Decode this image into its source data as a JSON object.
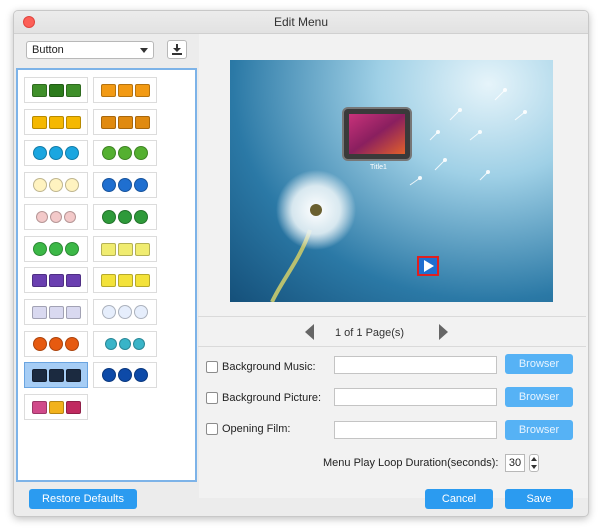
{
  "window": {
    "title": "Edit Menu"
  },
  "left": {
    "select_value": "Button",
    "thumbnails": [
      {
        "style": "sq",
        "colors": [
          "#3f8f2a",
          "#2c7b1c",
          "#3f8f2a"
        ]
      },
      {
        "style": "sq",
        "colors": [
          "#f29a14",
          "#f29a14",
          "#f29a14"
        ]
      },
      {
        "style": "sq",
        "colors": [
          "#f5b800",
          "#f5b800",
          "#f5b800"
        ]
      },
      {
        "style": "sq",
        "colors": [
          "#e08a10",
          "#e08a10",
          "#e08a10"
        ]
      },
      {
        "style": "ci",
        "colors": [
          "#1aa6e0",
          "#1aa6e0",
          "#1aa6e0"
        ]
      },
      {
        "style": "ci",
        "colors": [
          "#54b030",
          "#54b030",
          "#54b030"
        ]
      },
      {
        "style": "ci",
        "colors": [
          "#fff3c0",
          "#fff3c0",
          "#fff3c0"
        ]
      },
      {
        "style": "ci",
        "colors": [
          "#1f6fd0",
          "#1f6fd0",
          "#1f6fd0"
        ]
      },
      {
        "style": "sm",
        "colors": [
          "#f3c9c9",
          "#f3c9c9",
          "#f3c9c9"
        ]
      },
      {
        "style": "ci",
        "colors": [
          "#2e9a3a",
          "#2e9a3a",
          "#2e9a3a"
        ]
      },
      {
        "style": "ci",
        "colors": [
          "#3cb847",
          "#3cb847",
          "#3cb847"
        ]
      },
      {
        "style": "sq",
        "colors": [
          "#f0ec70",
          "#f0ec70",
          "#f0ec70"
        ]
      },
      {
        "style": "sq",
        "colors": [
          "#6a3fb0",
          "#6a3fb0",
          "#6a3fb0"
        ]
      },
      {
        "style": "sq",
        "colors": [
          "#f3e23a",
          "#f3e23a",
          "#f3e23a"
        ]
      },
      {
        "style": "sq",
        "colors": [
          "#d9d9f0",
          "#d9d9f0",
          "#d9d9f0"
        ]
      },
      {
        "style": "ci",
        "colors": [
          "#e6eefc",
          "#e6eefc",
          "#e6eefc"
        ]
      },
      {
        "style": "ci",
        "colors": [
          "#e65a10",
          "#e65a10",
          "#e65a10"
        ]
      },
      {
        "style": "sm",
        "colors": [
          "#39b4c8",
          "#39b4c8",
          "#39b4c8"
        ]
      },
      {
        "style": "sq",
        "colors": [
          "#1b2a40",
          "#1b2a40",
          "#1b2a40"
        ]
      },
      {
        "style": "ci",
        "colors": [
          "#0d4aa8",
          "#0d4aa8",
          "#0d4aa8"
        ]
      },
      {
        "style": "sq",
        "colors": [
          "#d04a8a",
          "#f2b21c",
          "#c02a60"
        ]
      }
    ]
  },
  "preview": {
    "caption": "Title1"
  },
  "pager": {
    "text": "1 of 1 Page(s)"
  },
  "options": {
    "bg_music_label": "Background Music:",
    "bg_picture_label": "Background Picture:",
    "opening_film_label": "Opening Film:",
    "browser_label": "Browser",
    "loop_label": "Menu Play Loop Duration(seconds):",
    "loop_value": "30"
  },
  "footer": {
    "restore_label": "Restore Defaults",
    "cancel_label": "Cancel",
    "save_label": "Save"
  },
  "colors": {
    "accent": "#2b9bf0",
    "selection": "#7db3e8"
  }
}
